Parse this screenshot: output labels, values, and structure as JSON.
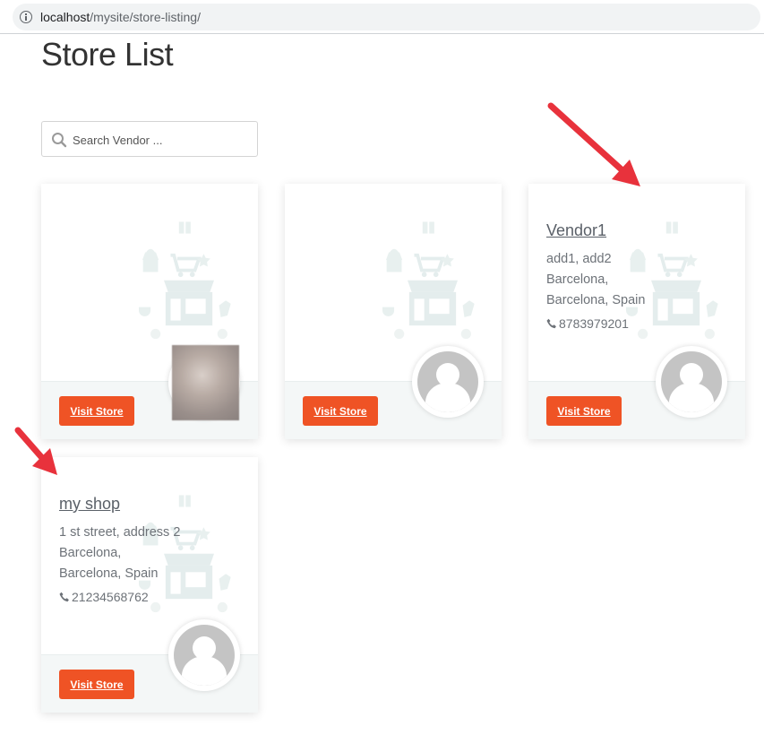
{
  "browser": {
    "url_host": "localhost",
    "url_path": "/mysite/store-listing/"
  },
  "page": {
    "title": "Store List"
  },
  "search": {
    "placeholder": "Search Vendor ..."
  },
  "stores": [
    {
      "name": "",
      "address_line1": "",
      "address_line2": "",
      "address_line3": "",
      "phone": "",
      "button_label": "Visit Store",
      "avatar": "photo"
    },
    {
      "name": "",
      "address_line1": "",
      "address_line2": "",
      "address_line3": "",
      "phone": "",
      "button_label": "Visit Store",
      "avatar": "default"
    },
    {
      "name": "Vendor1",
      "address_line1": "add1, add2",
      "address_line2": "Barcelona,",
      "address_line3": "Barcelona, Spain",
      "phone": "8783979201",
      "button_label": "Visit Store",
      "avatar": "default"
    },
    {
      "name": "my shop",
      "address_line1": "1 st street, address 2",
      "address_line2": "Barcelona,",
      "address_line3": "Barcelona, Spain",
      "phone": "21234568762",
      "button_label": "Visit Store",
      "avatar": "default"
    }
  ],
  "colors": {
    "button": "#ef5325",
    "arrow": "#e8323c",
    "footer": "#f4f7f7"
  }
}
